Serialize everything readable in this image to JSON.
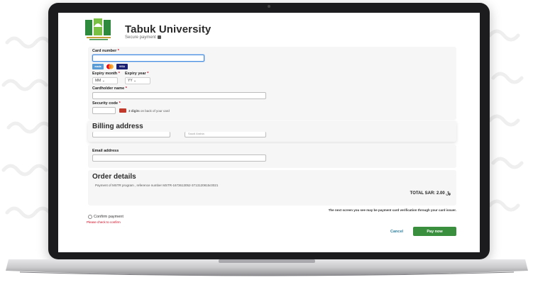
{
  "brand": {
    "name": "Tabuk University",
    "subtitle": "Secure payment"
  },
  "card": {
    "number_label": "Card number",
    "required_mark": "*",
    "logos": [
      "mada",
      "mastercard",
      "VISA"
    ],
    "expiry_month_label": "Expiry month",
    "expiry_year_label": "Expiry year",
    "expiry_month_value": "MM",
    "expiry_year_value": "YY",
    "holder_label": "Cardholder name",
    "security_label": "Security code",
    "security_hint_bold": "3 digits",
    "security_hint": "on back of your card"
  },
  "billing": {
    "title": "Billing address",
    "partial_field": "Saudi Arabia"
  },
  "email": {
    "label": "Email address"
  },
  "order": {
    "title": "Order details",
    "description": "Payment of MSTR program , reference number MSTR-1673613052-3713120815c0021",
    "total_label": "TOTAL SAR:",
    "total_value": "2.00"
  },
  "footer": {
    "notice": "The next screen you see may be payment card verification through your card issuer.",
    "confirm_label": "Confirm payment",
    "error": "Please check to confirm",
    "cancel": "Cancel",
    "pay": "Pay now"
  },
  "colors": {
    "pay_button": "#3a8f3f",
    "error": "#d0021b",
    "cancel": "#2e7d9a",
    "panel": "#f6f6f6"
  }
}
